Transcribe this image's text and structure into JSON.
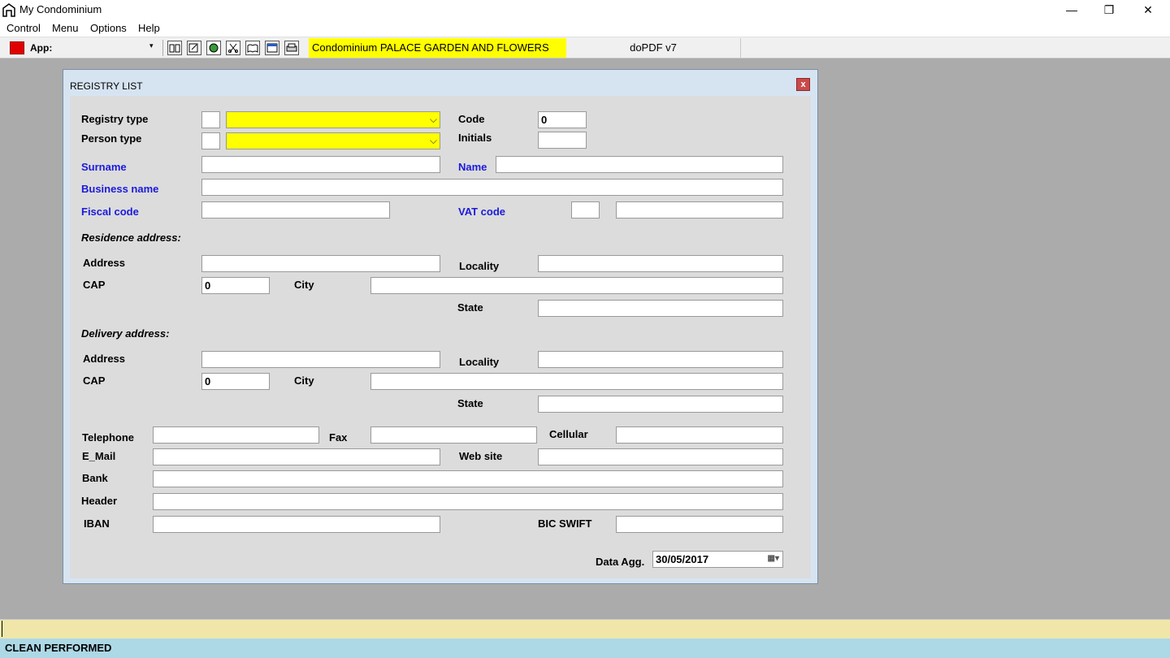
{
  "window": {
    "title": "My Condominium",
    "min_glyph": "—",
    "max_glyph": "❐",
    "close_glyph": "✕"
  },
  "menu": [
    "Control",
    "Menu",
    "Options",
    "Help"
  ],
  "toolbar": {
    "app_label": "App:",
    "dropdown_glyph": "▾",
    "tool_icons": [
      "book-icon",
      "edit-icon",
      "globe-icon",
      "scissors-icon",
      "open-book-icon",
      "window-icon",
      "printer-icon"
    ],
    "condominium": "Condominium PALACE GARDEN AND FLOWERS",
    "printer": "doPDF v7"
  },
  "dialog": {
    "title": "REGISTRY LIST",
    "close_glyph": "x",
    "labels": {
      "registry_type": "Registry type",
      "person_type": "Person type",
      "code": "Code",
      "initials": "Initials",
      "surname": "Surname",
      "name": "Name",
      "business_name": "Business name",
      "fiscal_code": "Fiscal code",
      "vat_code": "VAT code",
      "residence_address": "Residence address:",
      "address": "Address",
      "locality": "Locality",
      "cap": "CAP",
      "city": "City",
      "state": "State",
      "delivery_address": "Delivery address:",
      "telephone": "Telephone",
      "fax": "Fax",
      "cellular": "Cellular",
      "email": "E_Mail",
      "website": "Web site",
      "bank": "Bank",
      "header": "Header",
      "iban": "IBAN",
      "bic_swift": "BIC SWIFT",
      "data_agg": "Data Agg."
    },
    "values": {
      "code": "0",
      "residence_cap": "0",
      "delivery_cap": "0",
      "data_agg": "30/05/2017"
    },
    "combo_arrow": "⌵",
    "date_icon": "▦▾"
  },
  "status": {
    "message": "CLEAN PERFORMED"
  }
}
